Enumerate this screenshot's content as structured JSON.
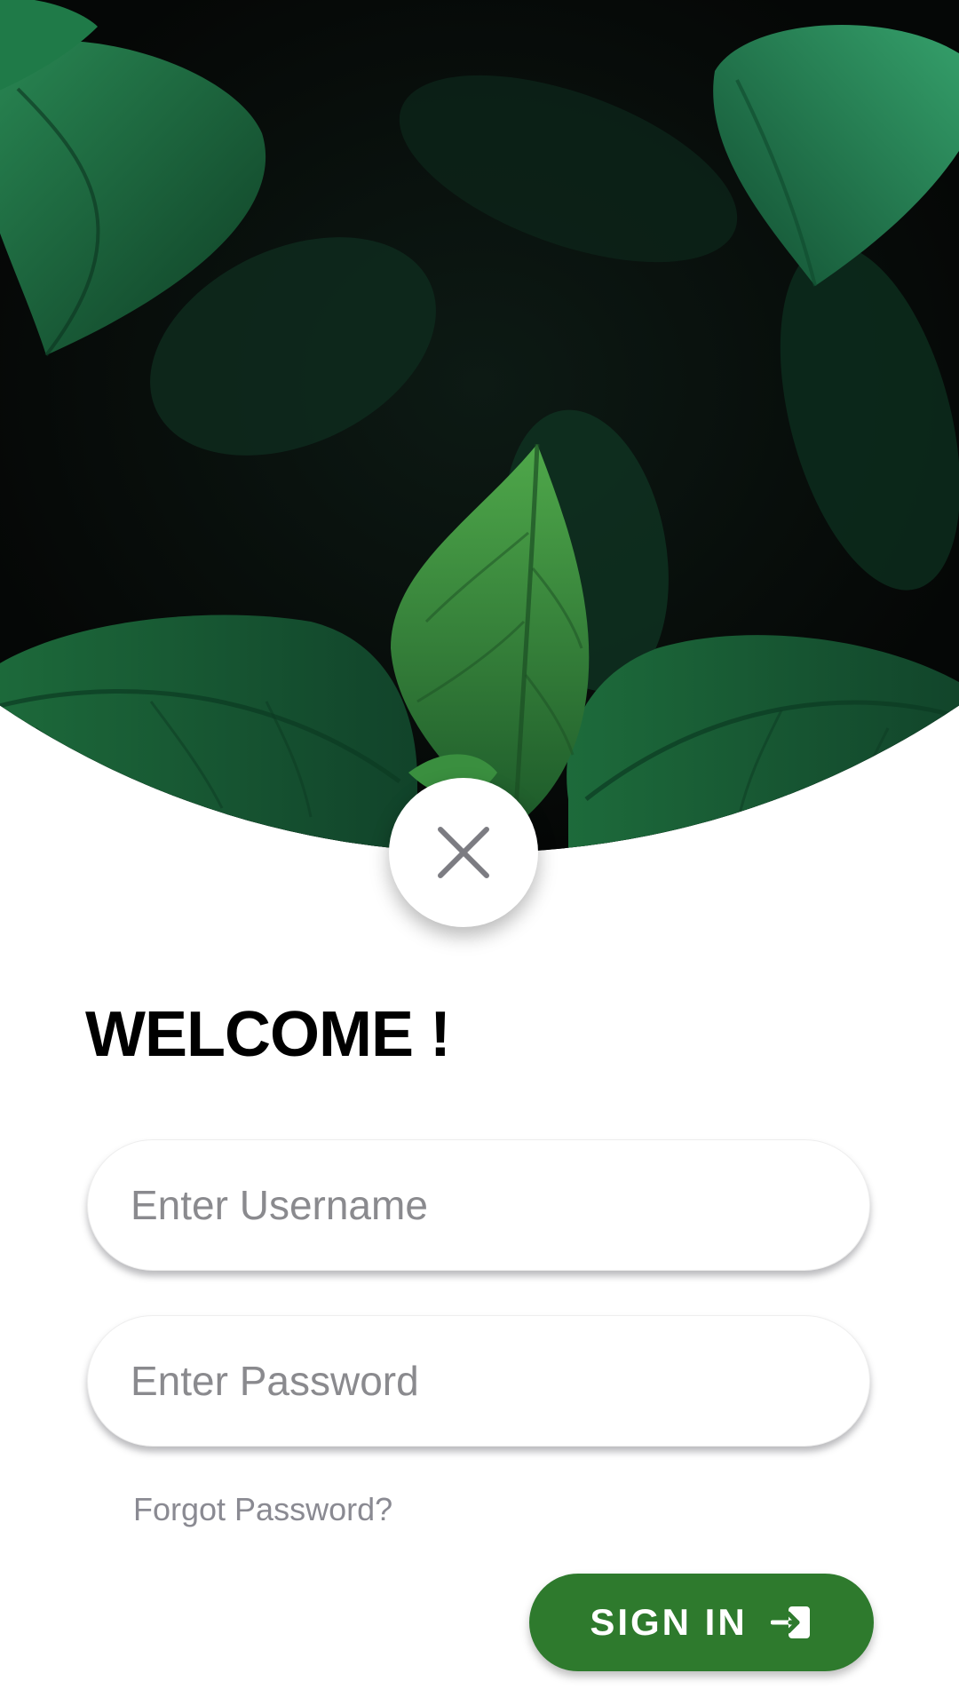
{
  "hero": {
    "image_name": "green-leaves-photo"
  },
  "close_button": {
    "icon": "close-icon"
  },
  "welcome": {
    "title": "WELCOME !"
  },
  "username": {
    "placeholder": "Enter Username",
    "value": ""
  },
  "password": {
    "placeholder": "Enter Password",
    "value": ""
  },
  "forgot": {
    "label": "Forgot Password?"
  },
  "signin": {
    "label": "SIGN IN",
    "icon": "login-icon"
  },
  "colors": {
    "accent": "#2e7a2d",
    "hero_background": "#060808",
    "placeholder": "#8a8a8e",
    "link": "#8a8a92"
  }
}
